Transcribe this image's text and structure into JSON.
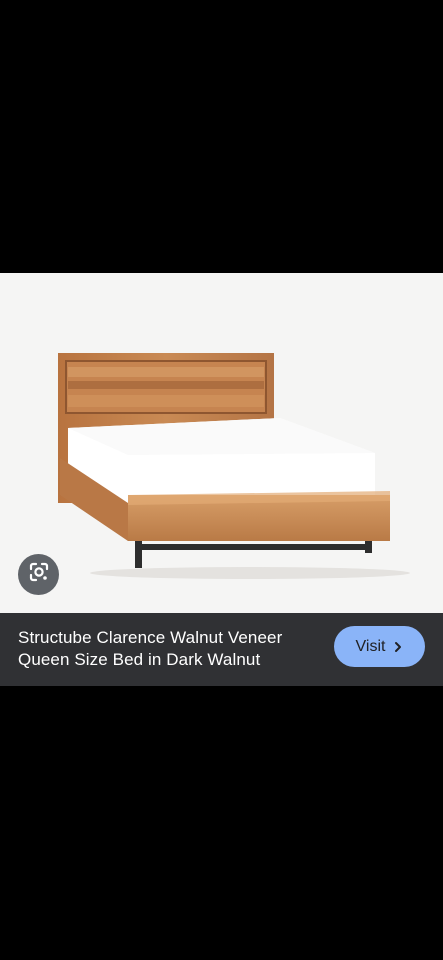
{
  "product": {
    "title": "Structube Clarence Walnut Veneer Queen Size Bed in Dark Walnut",
    "image_subject": "walnut-bed-photo"
  },
  "actions": {
    "visit_label": "Visit",
    "visit_icon": "chevron-right-icon",
    "lens_icon": "google-lens-icon"
  },
  "colors": {
    "caption_background": "#303134",
    "visit_button": "#8ab4f8",
    "lens_button": "#5f6368"
  }
}
